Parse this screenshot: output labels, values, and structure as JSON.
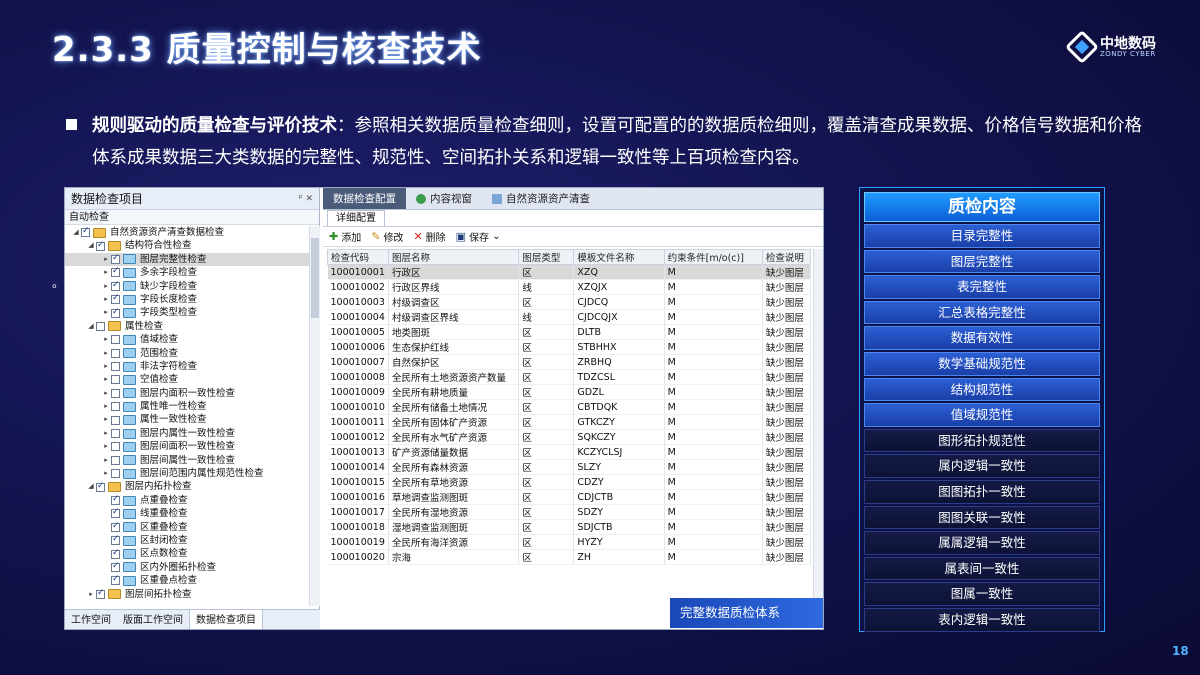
{
  "slide": {
    "title": "2.3.3 质量控制与核查技术",
    "logo_cn": "中地数码",
    "logo_en": "ZONDY CYBER",
    "bullet_bold": "规则驱动的质量检查与评价技术",
    "bullet_text": "：参照相关数据质量检查细则，设置可配置的的数据质检细则，覆盖清查成果数据、价格信号数据和价格体系成果数据三大类数据的完整性、规范性、空间拓扑关系和逻辑一致性等上百项检查内容。",
    "stray_mark": "。",
    "page_number": "18",
    "banner": "完整数据质检体系"
  },
  "left_panel": {
    "header": "数据检查项目",
    "header_icons": "ᵖ ✕",
    "subheader": "自动检查",
    "tree": [
      {
        "label": "自然资源资产清查数据检查",
        "level": 0,
        "check": true,
        "icon": "db",
        "expand": "◢"
      },
      {
        "label": "结构符合性检查",
        "level": 1,
        "check": true,
        "icon": "db",
        "expand": "◢"
      },
      {
        "label": "图层完整性检查",
        "level": 2,
        "check": true,
        "icon": "fld",
        "expand": "▸",
        "selected": true
      },
      {
        "label": "多余字段检查",
        "level": 2,
        "check": true,
        "icon": "fld",
        "expand": "▸"
      },
      {
        "label": "缺少字段检查",
        "level": 2,
        "check": true,
        "icon": "fld",
        "expand": "▸"
      },
      {
        "label": "字段长度检查",
        "level": 2,
        "check": true,
        "icon": "fld",
        "expand": "▸"
      },
      {
        "label": "字段类型检查",
        "level": 2,
        "check": true,
        "icon": "fld",
        "expand": "▸"
      },
      {
        "label": "属性检查",
        "level": 1,
        "check": false,
        "icon": "db",
        "expand": "◢"
      },
      {
        "label": "值域检查",
        "level": 2,
        "check": false,
        "icon": "fld",
        "expand": "▸"
      },
      {
        "label": "范围检查",
        "level": 2,
        "check": false,
        "icon": "fld",
        "expand": "▸"
      },
      {
        "label": "非法字符检查",
        "level": 2,
        "check": false,
        "icon": "fld",
        "expand": "▸"
      },
      {
        "label": "空值检查",
        "level": 2,
        "check": false,
        "icon": "fld",
        "expand": "▸"
      },
      {
        "label": "图层内面积一致性检查",
        "level": 2,
        "check": false,
        "icon": "fld",
        "expand": "▸"
      },
      {
        "label": "属性唯一性检查",
        "level": 2,
        "check": false,
        "icon": "fld",
        "expand": "▸"
      },
      {
        "label": "属性一致性检查",
        "level": 2,
        "check": false,
        "icon": "fld",
        "expand": "▸"
      },
      {
        "label": "图层内属性一致性检查",
        "level": 2,
        "check": false,
        "icon": "fld",
        "expand": "▸"
      },
      {
        "label": "图层间面积一致性检查",
        "level": 2,
        "check": false,
        "icon": "fld",
        "expand": "▸"
      },
      {
        "label": "图层间属性一致性检查",
        "level": 2,
        "check": false,
        "icon": "fld",
        "expand": "▸"
      },
      {
        "label": "图层间范围内属性规范性检查",
        "level": 2,
        "check": false,
        "icon": "fld",
        "expand": "▸"
      },
      {
        "label": "图层内拓扑检查",
        "level": 1,
        "check": true,
        "icon": "db",
        "expand": "◢"
      },
      {
        "label": "点重叠检查",
        "level": 2,
        "check": true,
        "icon": "fld",
        "expand": ""
      },
      {
        "label": "线重叠检查",
        "level": 2,
        "check": true,
        "icon": "fld",
        "expand": ""
      },
      {
        "label": "区重叠检查",
        "level": 2,
        "check": true,
        "icon": "fld",
        "expand": ""
      },
      {
        "label": "区封闭检查",
        "level": 2,
        "check": true,
        "icon": "fld",
        "expand": ""
      },
      {
        "label": "区点数检查",
        "level": 2,
        "check": true,
        "icon": "fld",
        "expand": ""
      },
      {
        "label": "区内外圈拓扑检查",
        "level": 2,
        "check": true,
        "icon": "fld",
        "expand": ""
      },
      {
        "label": "区重叠点检查",
        "level": 2,
        "check": true,
        "icon": "fld",
        "expand": ""
      },
      {
        "label": "图层间拓扑检查",
        "level": 1,
        "check": true,
        "icon": "db",
        "expand": "▸"
      }
    ],
    "tabs": [
      "工作空间",
      "版面工作空间",
      "数据检查项目"
    ]
  },
  "right_panel": {
    "tabs": [
      "数据检查配置",
      "内容视窗",
      "自然资源资产清查"
    ],
    "subtab": "详细配置",
    "toolbar": {
      "add": "添加",
      "edit": "修改",
      "delete": "删除",
      "save": "保存",
      "dropdown": "⌄"
    },
    "columns": [
      "检查代码",
      "图层名称",
      "图层类型",
      "模板文件名称",
      "约束条件[m/o(c)]",
      "检查说明"
    ],
    "rows": [
      [
        "100010001",
        "行政区",
        "区",
        "XZQ",
        "M",
        "缺少图层"
      ],
      [
        "100010002",
        "行政区界线",
        "线",
        "XZQJX",
        "M",
        "缺少图层"
      ],
      [
        "100010003",
        "村级调查区",
        "区",
        "CJDCQ",
        "M",
        "缺少图层"
      ],
      [
        "100010004",
        "村级调查区界线",
        "线",
        "CJDCQJX",
        "M",
        "缺少图层"
      ],
      [
        "100010005",
        "地类图斑",
        "区",
        "DLTB",
        "M",
        "缺少图层"
      ],
      [
        "100010006",
        "生态保护红线",
        "区",
        "STBHHX",
        "M",
        "缺少图层"
      ],
      [
        "100010007",
        "自然保护区",
        "区",
        "ZRBHQ",
        "M",
        "缺少图层"
      ],
      [
        "100010008",
        "全民所有土地资源资产数量",
        "区",
        " TDZCSL",
        "M",
        "缺少图层"
      ],
      [
        "100010009",
        "全民所有耕地质量",
        "区",
        "GDZL",
        "M",
        "缺少图层"
      ],
      [
        "100010010",
        "全民所有储备土地情况",
        "区",
        "CBTDQK",
        "M",
        "缺少图层"
      ],
      [
        "100010011",
        "全民所有固体矿产资源",
        "区",
        "GTKCZY",
        "M",
        "缺少图层"
      ],
      [
        "100010012",
        "全民所有水气矿产资源",
        "区",
        "SQKCZY",
        "M",
        "缺少图层"
      ],
      [
        "100010013",
        "矿产资源储量数据",
        "区",
        "KCZYCLSJ",
        "M",
        "缺少图层"
      ],
      [
        "100010014",
        "全民所有森林资源",
        "区",
        "SLZY",
        "M",
        "缺少图层"
      ],
      [
        "100010015",
        "全民所有草地资源",
        "区",
        "CDZY",
        "M",
        "缺少图层"
      ],
      [
        "100010016",
        "草地调查监测图斑",
        "区",
        "CDJCTB",
        "M",
        "缺少图层"
      ],
      [
        "100010017",
        "全民所有湿地资源",
        "区",
        "SDZY",
        "M",
        "缺少图层"
      ],
      [
        "100010018",
        "湿地调查监测图斑",
        "区",
        "SDJCTB",
        "M",
        "缺少图层"
      ],
      [
        "100010019",
        "全民所有海洋资源",
        "区",
        "HYZY",
        "M",
        "缺少图层"
      ],
      [
        "100010020",
        "宗海",
        "区",
        "ZH",
        "M",
        "缺少图层"
      ]
    ]
  },
  "quality_panel": {
    "header": "质检内容",
    "items": [
      "目录完整性",
      "图层完整性",
      "表完整性",
      "汇总表格完整性",
      "数据有效性",
      "数学基础规范性",
      "结构规范性",
      "值域规范性",
      "图形拓扑规范性",
      "属内逻辑一致性",
      "图图拓扑一致性",
      "图图关联一致性",
      "属属逻辑一致性",
      "属表间一致性",
      "图属一致性",
      "表内逻辑一致性"
    ],
    "dark_from": 8
  }
}
